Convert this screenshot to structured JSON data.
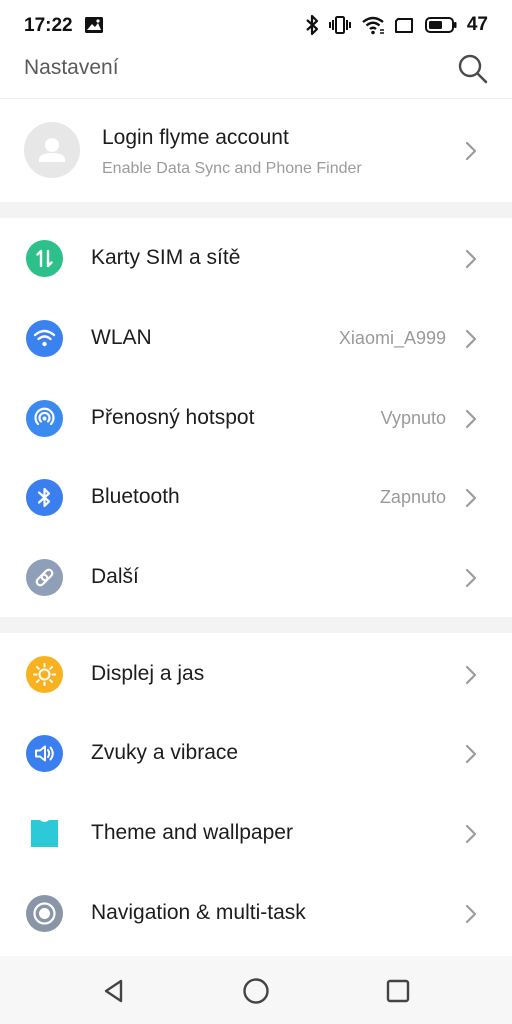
{
  "status_bar": {
    "time": "17:22",
    "battery_level": "47",
    "icons": [
      "image-icon",
      "bluetooth-icon",
      "vibrate-icon",
      "wifi-icon",
      "screen-icon",
      "battery-icon"
    ]
  },
  "app_bar": {
    "title": "Nastavení",
    "search_icon": "search-icon"
  },
  "account": {
    "title": "Login flyme account",
    "subtitle": "Enable Data Sync and Phone Finder",
    "avatar_icon": "person-icon"
  },
  "sections": [
    {
      "items": [
        {
          "label": "Karty SIM a sítě",
          "value": "",
          "icon": "sim-icon",
          "color": "#2dc08b"
        },
        {
          "label": "WLAN",
          "value": "Xiaomi_A999",
          "icon": "wifi-icon",
          "color": "#3a82f0"
        },
        {
          "label": "Přenosný hotspot",
          "value": "Vypnuto",
          "icon": "hotspot-icon",
          "color": "#3a8af0"
        },
        {
          "label": "Bluetooth",
          "value": "Zapnuto",
          "icon": "bluetooth-icon",
          "color": "#3a7ef0"
        },
        {
          "label": "Další",
          "value": "",
          "icon": "link-icon",
          "color": "#8f9fb7"
        }
      ]
    },
    {
      "items": [
        {
          "label": "Displej a jas",
          "value": "",
          "icon": "sun-icon",
          "color": "#f8b21f"
        },
        {
          "label": "Zvuky a vibrace",
          "value": "",
          "icon": "speaker-icon",
          "color": "#3a7ef0"
        },
        {
          "label": "Theme and wallpaper",
          "value": "",
          "icon": "shirt-icon",
          "color": "#2cc9d6"
        },
        {
          "label": "Navigation & multi-task",
          "value": "",
          "icon": "navigation-icon",
          "color": "#8a96a8"
        }
      ]
    }
  ],
  "nav_bar": {
    "buttons": [
      "back-icon",
      "home-icon",
      "recents-icon"
    ]
  }
}
